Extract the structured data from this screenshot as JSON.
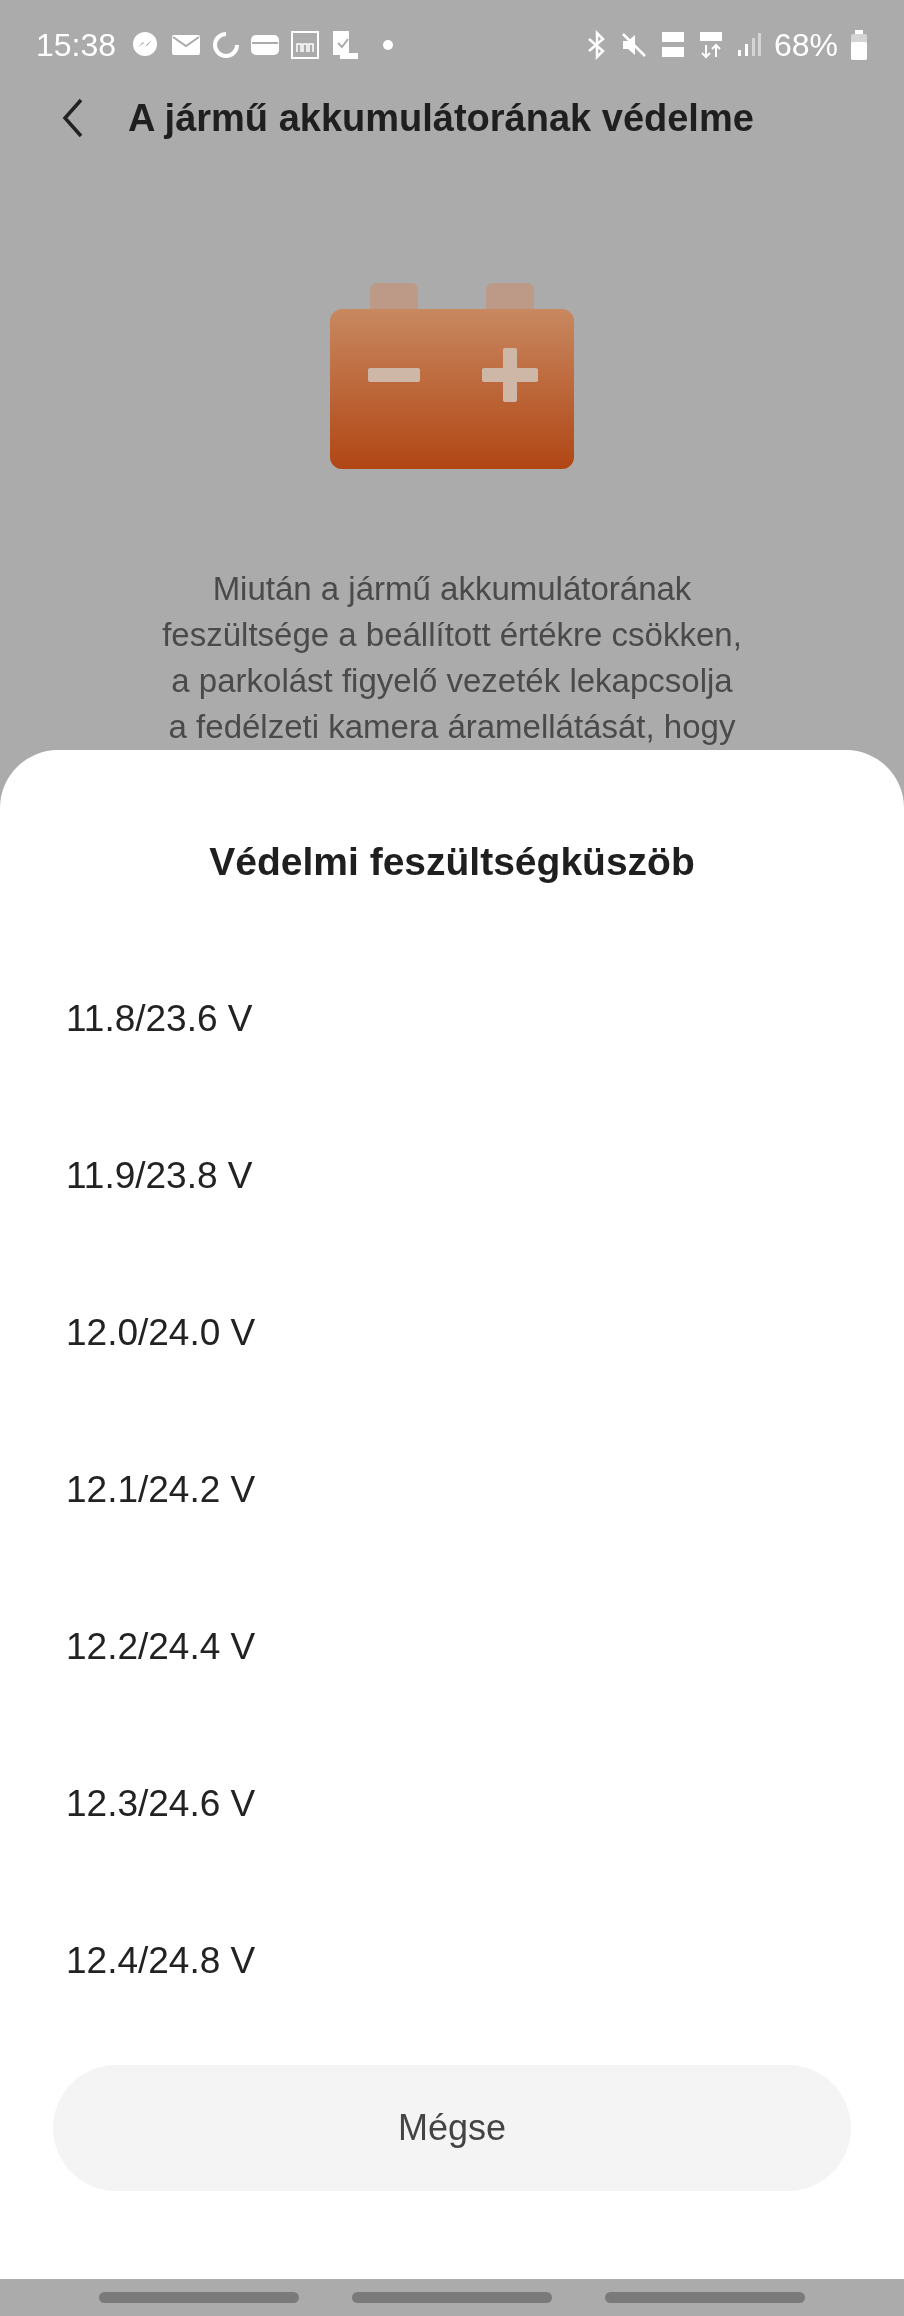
{
  "status_bar": {
    "time": "15:38",
    "battery": "68%"
  },
  "header": {
    "title": "A jármű akkumulátorának védelme"
  },
  "description": {
    "lines": [
      "Miután a jármű akkumulátorának",
      "feszültsége a beállított értékre csökken,",
      "a parkolást figyelő vezeték lekapcsolja",
      "a fedélzeti kamera áramellátását, hogy"
    ]
  },
  "sheet": {
    "title": "Védelmi feszültségküszöb",
    "options": [
      {
        "label": "11.8/23.6 V"
      },
      {
        "label": "11.9/23.8 V"
      },
      {
        "label": "12.0/24.0 V"
      },
      {
        "label": "12.1/24.2 V"
      },
      {
        "label": "12.2/24.4 V"
      },
      {
        "label": "12.3/24.6 V"
      },
      {
        "label": "12.4/24.8 V"
      }
    ],
    "cancel": "Mégse"
  }
}
